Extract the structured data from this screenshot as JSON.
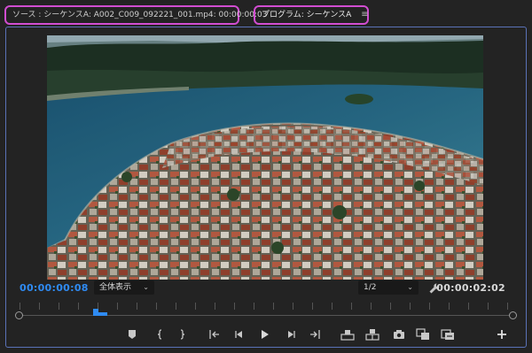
{
  "tabs": {
    "source": {
      "label": "ソース : シーケンスA: A002_C009_092221_001.mp4: 00:00:00:03"
    },
    "program": {
      "label": "プログラム: シーケンスA",
      "menu_icon": "hamburger-menu-icon"
    }
  },
  "monitor": {
    "current_timecode": "00:00:00:08",
    "duration_timecode": "00:00:02:02",
    "fit_select": {
      "value": "全体表示"
    },
    "resolution_select": {
      "value": "1/2"
    }
  },
  "timeline": {
    "playhead_fraction": 0.15
  },
  "transport_icons": [
    "add-marker-icon",
    "mark-in-icon",
    "mark-out-icon",
    "go-to-in-icon",
    "step-back-icon",
    "play-icon",
    "step-forward-icon",
    "go-to-out-icon",
    "lift-icon",
    "extract-icon",
    "export-frame-icon",
    "compare-view-icon",
    "proxy-toggle-icon",
    "button-editor-icon"
  ],
  "colors": {
    "highlight_border": "#d14dd1",
    "panel_border": "#5a73b8",
    "timecode_blue": "#2f8bf3",
    "background": "#232323"
  }
}
